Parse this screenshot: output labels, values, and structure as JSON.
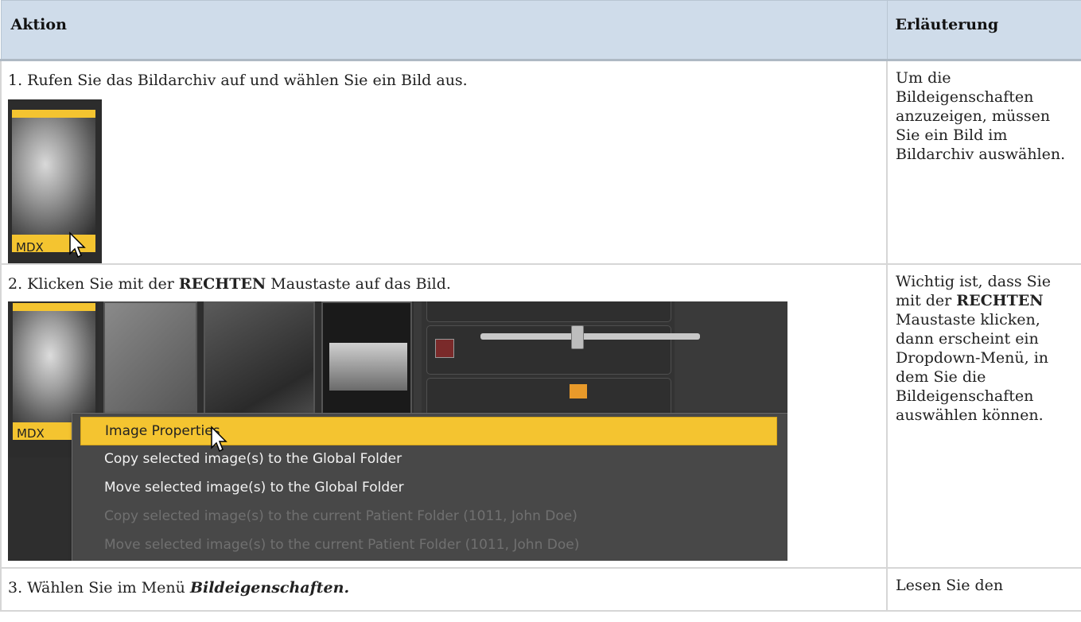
{
  "header": {
    "col_action": "Aktion",
    "col_explanation": "Erläuterung"
  },
  "rows": [
    {
      "step_text": "1. Rufen Sie das Bildarchiv auf und wählen Sie ein Bild aus.",
      "thumb_label": "MDX",
      "explanation": "Um die Bildeigenschaften anzuzeigen, müssen Sie ein Bild im Bildarchiv auswählen."
    },
    {
      "step_pre": "2. Klicken Sie mit der ",
      "step_bold": "RECHTEN",
      "step_post": " Maustaste auf das Bild.",
      "thumb_label": "MDX",
      "menu": [
        "Image Properties",
        "Copy selected image(s) to the Global Folder",
        "Move selected image(s) to the Global Folder",
        "Copy selected image(s) to the current Patient Folder (1011, John Doe)",
        "Move selected image(s) to the current Patient Folder (1011, John Doe)"
      ],
      "explanation_pre": "Wichtig ist, dass Sie mit der ",
      "explanation_bold": "RECHTEN",
      "explanation_post": " Maustaste klicken, dann erscheint ein Dropdown-Menü, in dem Sie die Bildeigenschaften auswählen können."
    },
    {
      "step_pre": "3. Wählen Sie im Menü ",
      "step_bold_italic": "Bildeigenschaften.",
      "explanation": "Lesen Sie den"
    }
  ]
}
